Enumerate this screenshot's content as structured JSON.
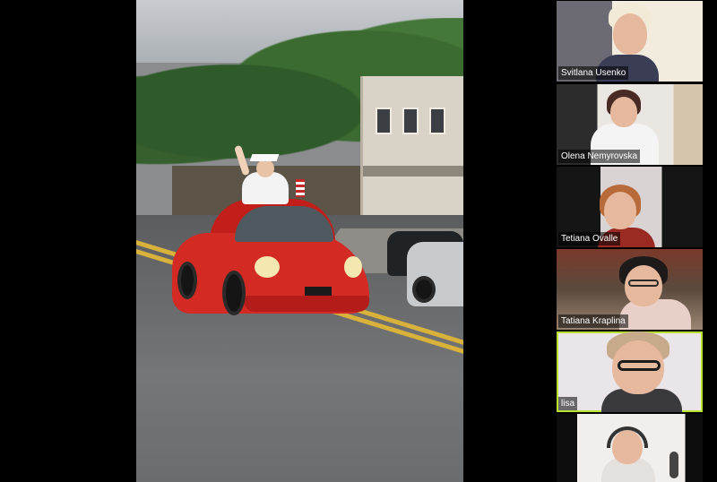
{
  "meeting": {
    "shared_view": {
      "label": "shared-video",
      "scene_icon": "parade-car-icon"
    },
    "participants": [
      {
        "name": "Svitlana Usenko",
        "active_speaker": false
      },
      {
        "name": "Olena Nemyrovska",
        "active_speaker": false
      },
      {
        "name": "Tetiana Ovalle",
        "active_speaker": false
      },
      {
        "name": "Tatiana Kraplina",
        "active_speaker": false
      },
      {
        "name": "lisa",
        "active_speaker": true
      },
      {
        "name": "",
        "active_speaker": false
      }
    ]
  },
  "colors": {
    "background": "#000000",
    "active_speaker_border": "#b8e22e",
    "name_tag_text": "#ffffff"
  }
}
